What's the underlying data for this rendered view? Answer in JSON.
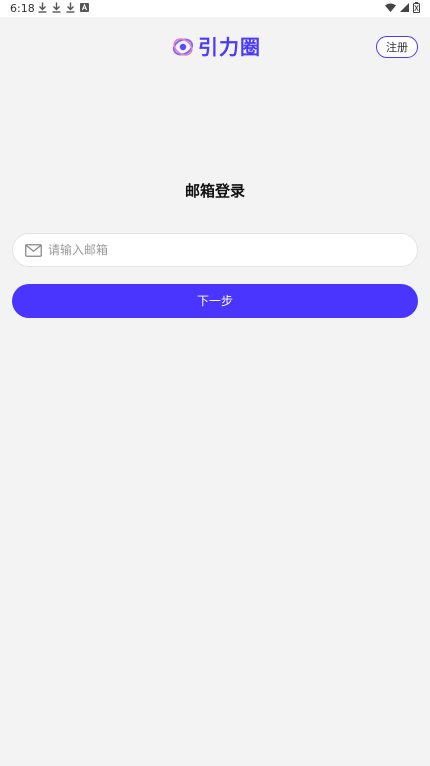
{
  "status_bar": {
    "time": "6:18",
    "left_icons": [
      "download-icon",
      "download-icon",
      "download-icon",
      "a-icon"
    ],
    "right_icons": [
      "wifi-icon",
      "signal-icon",
      "battery-icon"
    ]
  },
  "header": {
    "logo_text": "引力圈",
    "register_label": "注册"
  },
  "main": {
    "title": "邮箱登录",
    "email_input": {
      "value": "",
      "placeholder": "请输入邮箱"
    },
    "next_label": "下一步"
  },
  "colors": {
    "accent": "#4a34ff",
    "background": "#f3f3f3"
  }
}
